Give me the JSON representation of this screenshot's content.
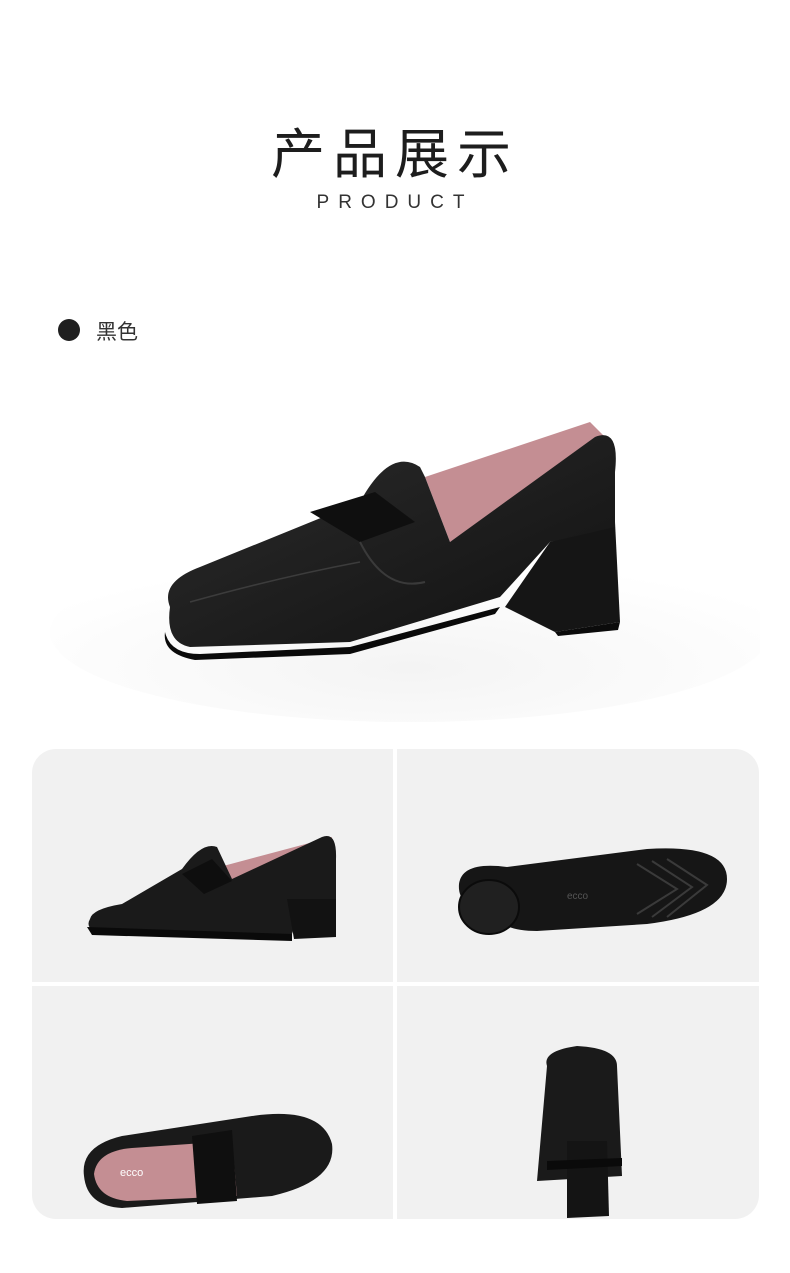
{
  "header": {
    "title": "产品展示",
    "subtitle": "PRODUCT"
  },
  "color_option": {
    "swatch_color": "#1f1f1f",
    "label": "黑色"
  },
  "gallery": {
    "views": [
      {
        "view": "side",
        "icon": "shoe-side-view"
      },
      {
        "view": "sole",
        "icon": "shoe-sole-view",
        "brand_mark": "ecco"
      },
      {
        "view": "top",
        "icon": "shoe-top-view",
        "brand_mark": "ecco"
      },
      {
        "view": "back",
        "icon": "shoe-back-view"
      }
    ]
  },
  "colors": {
    "leather": "#1b1b1b",
    "lining": "#c48e93",
    "tile_bg": "#f1f1f1"
  }
}
